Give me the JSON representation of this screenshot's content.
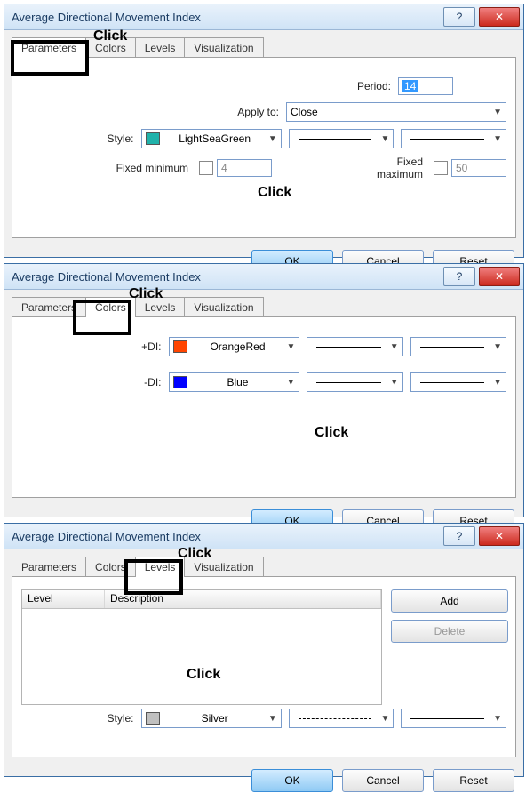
{
  "dialog1": {
    "title": "Average Directional Movement Index",
    "tabs": {
      "parameters": "Parameters",
      "colors": "Colors",
      "levels": "Levels",
      "viz": "Visualization"
    },
    "periodLabel": "Period:",
    "period": "14",
    "applyLabel": "Apply to:",
    "applyValue": "Close",
    "styleLabel": "Style:",
    "styleColorName": "LightSeaGreen",
    "styleColorHex": "#20B2AA",
    "fminLabel": "Fixed minimum",
    "fmin": "4",
    "fmaxLabel": "Fixed maximum",
    "fmax": "50",
    "ok": "OK",
    "cancel": "Cancel",
    "reset": "Reset",
    "annot_highlight": "Click",
    "annot_arrows": "Click"
  },
  "dialog2": {
    "title": "Average Directional Movement Index",
    "tabs": {
      "parameters": "Parameters",
      "colors": "Colors",
      "levels": "Levels",
      "viz": "Visualization"
    },
    "plusDIlabel": "+DI:",
    "plusDIname": "OrangeRed",
    "plusDIhex": "#FF4500",
    "minusDIlabel": "-DI:",
    "minusDIname": "Blue",
    "minusDIhex": "#0000FF",
    "ok": "OK",
    "cancel": "Cancel",
    "reset": "Reset",
    "annot_highlight": "Click",
    "annot_arrows": "Click"
  },
  "dialog3": {
    "title": "Average Directional Movement Index",
    "tabs": {
      "parameters": "Parameters",
      "colors": "Colors",
      "levels": "Levels",
      "viz": "Visualization"
    },
    "colLevel": "Level",
    "colDesc": "Description",
    "add": "Add",
    "delete": "Delete",
    "styleLabel": "Style:",
    "styleColorName": "Silver",
    "styleColorHex": "#C0C0C0",
    "ok": "OK",
    "cancel": "Cancel",
    "reset": "Reset",
    "annot_highlight": "Click",
    "annot_arrows": "Click"
  }
}
